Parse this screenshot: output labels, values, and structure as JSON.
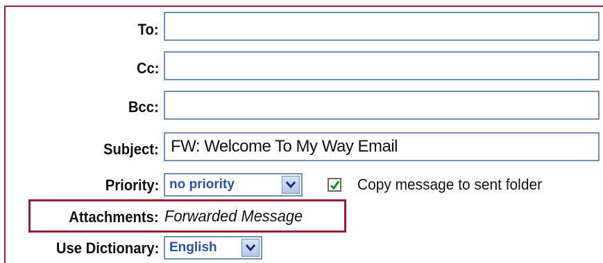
{
  "form": {
    "to": {
      "label": "To:",
      "value": ""
    },
    "cc": {
      "label": "Cc:",
      "value": ""
    },
    "bcc": {
      "label": "Bcc:",
      "value": ""
    },
    "subject": {
      "label": "Subject:",
      "value": "FW: Welcome To My Way Email"
    },
    "priority": {
      "label": "Priority:",
      "selected": "no priority"
    },
    "copy_to_sent": {
      "label": "Copy message to sent folder",
      "checked": true
    },
    "attachments": {
      "label": "Attachments:",
      "value": "Forwarded Message"
    },
    "dictionary": {
      "label": "Use Dictionary:",
      "selected": "English"
    }
  },
  "icons": {
    "dropdown": "chevron-down-icon",
    "check": "checkmark-icon"
  },
  "colors": {
    "frame": "#9a1c32",
    "highlight_box": "#9a1c32",
    "field_border": "#6f8fb8",
    "select_text": "#2a50b0",
    "checkmark": "#1a8a1a"
  }
}
